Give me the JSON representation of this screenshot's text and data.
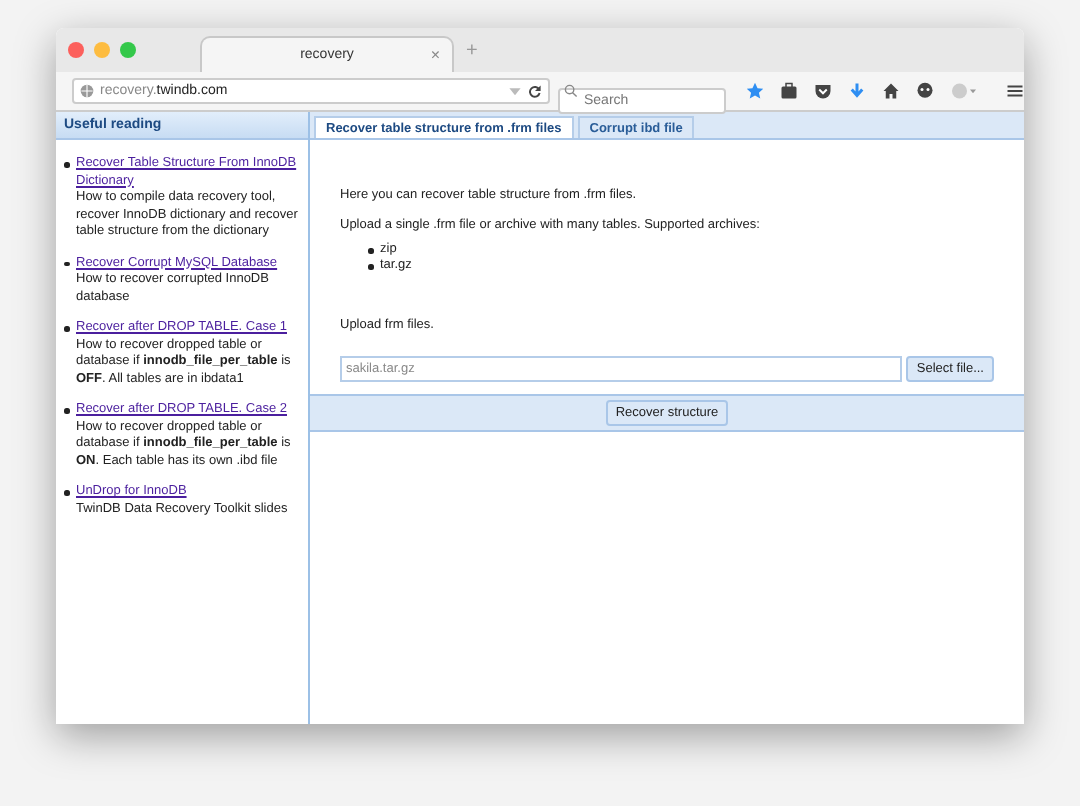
{
  "browser": {
    "tab_title": "recovery",
    "tab_close": "×",
    "new_tab": "+",
    "url": "recovery.**twindb.com**",
    "search": {
      "placeholder": "Search"
    }
  },
  "sidebar": {
    "title": "Useful reading",
    "items": [
      {
        "link": "Recover Table Structure From InnoDB Dictionary",
        "text": "How to compile data recovery tool, recover InnoDB dictionary and recover table structure from the dictionary"
      },
      {
        "link": "Recover Corrupt MySQL Database",
        "text": "How to recover corrupted InnoDB database"
      },
      {
        "link": "Recover after DROP TABLE. Case 1",
        "text": "How to recover dropped table or database if **innodb_file_per_table** is **OFF**. All tables are in ibdata1"
      },
      {
        "link": "Recover after DROP TABLE. Case 2",
        "text": "How to recover dropped table or database if **innodb_file_per_table** is **ON**. Each table has its own .ibd file"
      },
      {
        "link": "UnDrop for InnoDB",
        "text": "TwinDB Data Recovery Toolkit slides"
      }
    ]
  },
  "tabs": [
    {
      "label": "Recover table structure from .frm files",
      "selected": true
    },
    {
      "label": "Corrupt ibd file",
      "selected": false
    }
  ],
  "content": {
    "intro": "Here you can recover table structure from .frm files.",
    "upload_text": "Upload a single .frm file or archive with many tables. Supported archives:",
    "archives": [
      "zip",
      "tar.gz"
    ],
    "upload_label": "Upload frm files.",
    "file_field": {
      "placeholder": "sakila.tar.gz"
    },
    "select_button": "Select file...",
    "submit_button": "Recover structure"
  }
}
